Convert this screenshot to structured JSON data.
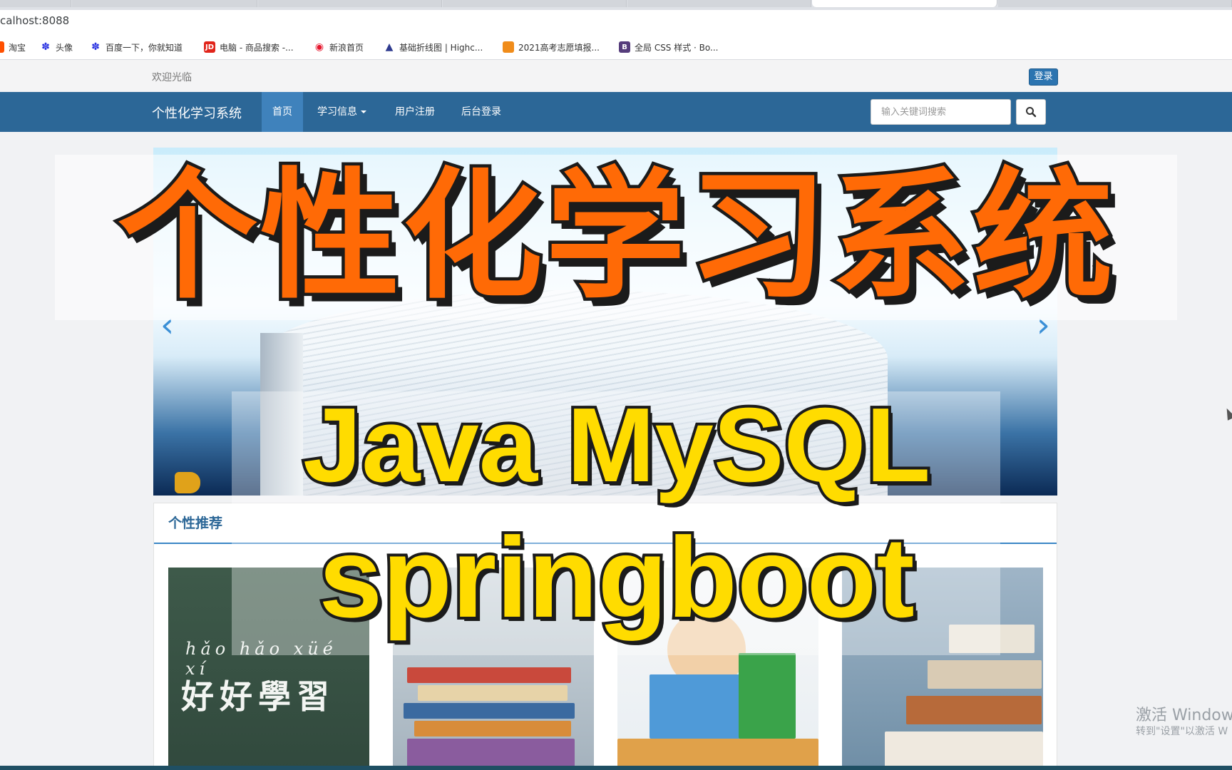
{
  "browser": {
    "url": "calhost:8088",
    "bookmarks": [
      {
        "label": "淘宝",
        "icon": "taobao-icon",
        "color": "#ff5000"
      },
      {
        "label": "头像",
        "icon": "baidu-paw-icon",
        "color": "#2932e1"
      },
      {
        "label": "百度一下，你就知道",
        "icon": "baidu-paw-icon",
        "color": "#2932e1"
      },
      {
        "label": "电脑 - 商品搜索 -...",
        "icon": "jd-icon",
        "color": "#e1251b"
      },
      {
        "label": "新浪首页",
        "icon": "sina-weibo-icon",
        "color": "#e6162d"
      },
      {
        "label": "基础折线图 | Highc...",
        "icon": "highcharts-icon",
        "color": "#2f3b8f"
      },
      {
        "label": "2021高考志愿填报...",
        "icon": "gaokao-icon",
        "color": "#f08c1a"
      },
      {
        "label": "全局 CSS 样式 · Bo...",
        "icon": "bootstrap-icon",
        "color": "#563d7c"
      }
    ],
    "jd_glyph": "JD",
    "bootstrap_glyph": "B"
  },
  "header": {
    "welcome": "欢迎光临",
    "login": "登录"
  },
  "navbar": {
    "brand": "个性化学习系统",
    "items": [
      {
        "label": "首页",
        "active": true
      },
      {
        "label": "学习信息",
        "dropdown": true
      },
      {
        "label": "用户注册"
      },
      {
        "label": "后台登录"
      }
    ],
    "search_placeholder": "输入关键词搜索"
  },
  "section": {
    "title": "个性推荐",
    "card1": {
      "pinyin": "hǎo hǎo xüé xí",
      "hanzi": "好好學習"
    }
  },
  "overlay": {
    "title": "个性化学习系统",
    "line1": "Java MySQL",
    "line2": "springboot"
  },
  "os": {
    "watermark_title": "激活 Windows",
    "watermark_sub": "转到\"设置\"以激活 W"
  }
}
